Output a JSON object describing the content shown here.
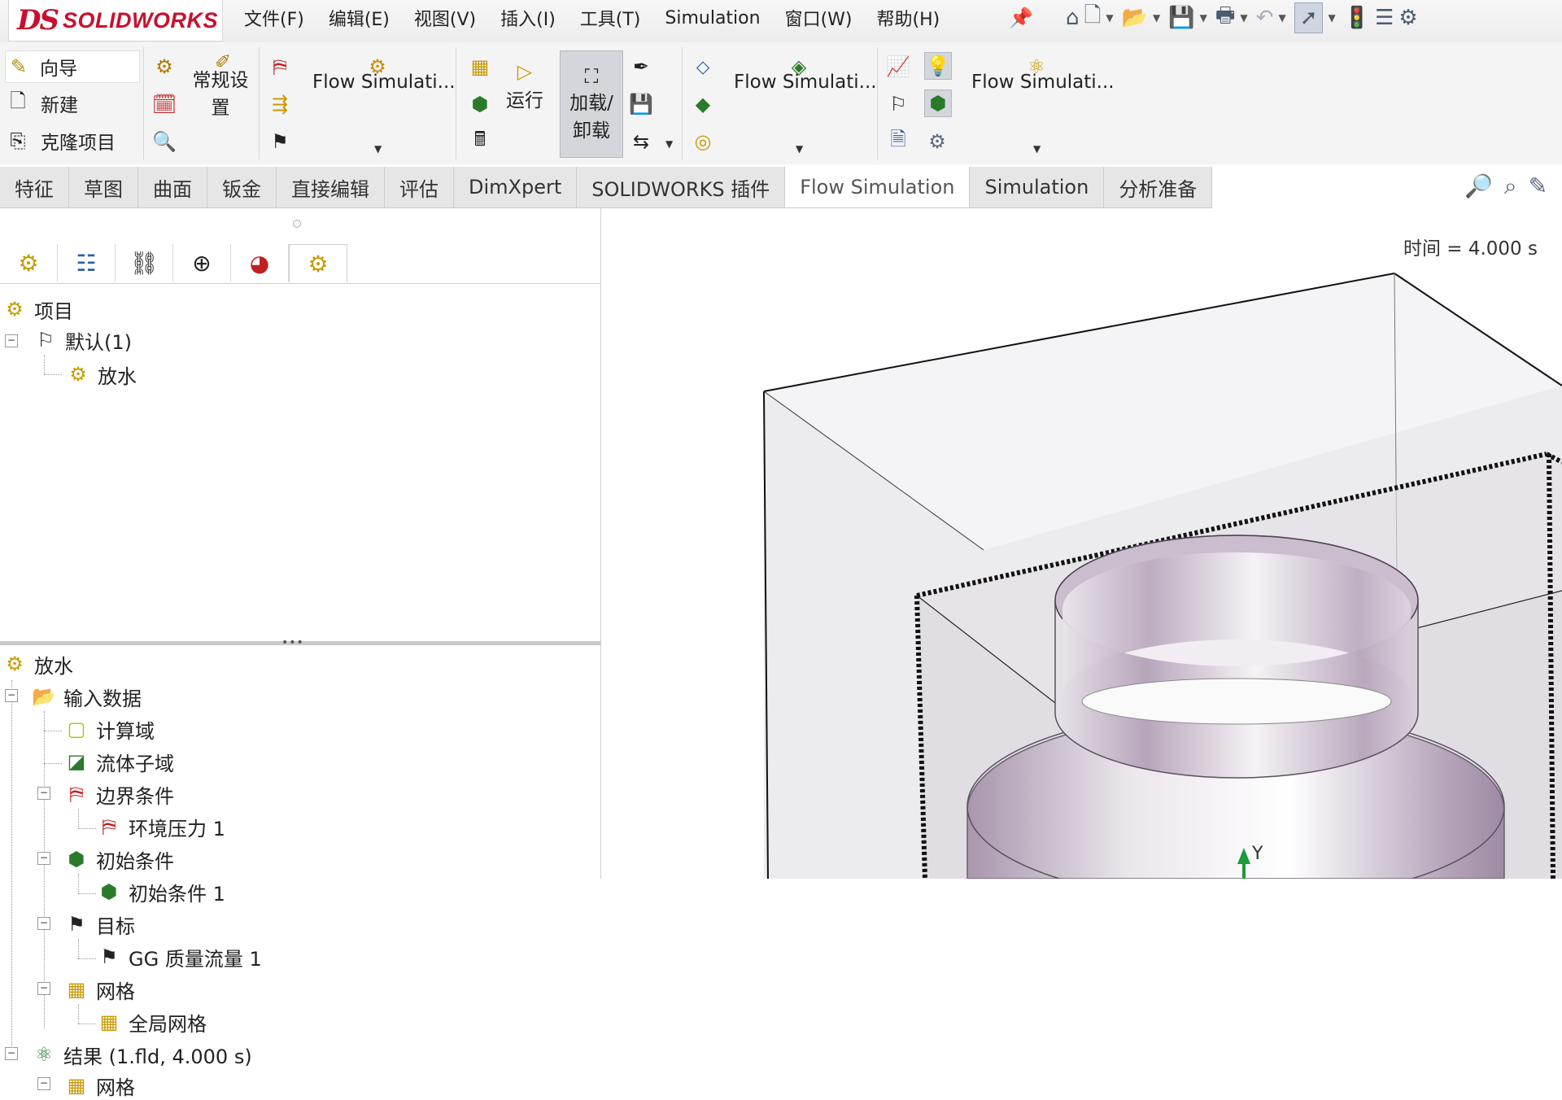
{
  "app": {
    "brand_ds": "DS",
    "brand_name": "SOLIDWORKS"
  },
  "menu": [
    "文件(F)",
    "编辑(E)",
    "视图(V)",
    "插入(I)",
    "工具(T)",
    "Simulation",
    "窗口(W)",
    "帮助(H)"
  ],
  "quick_access_icons": [
    "home-icon",
    "new-document-icon",
    "open-icon",
    "save-icon",
    "print-icon",
    "undo-icon",
    "select-cursor-icon",
    "traffic-light-icon",
    "options-list-icon",
    "gear-icon"
  ],
  "toolbar": {
    "wizard": "向导",
    "new": "新建",
    "clone_project": "克隆项目",
    "general_settings": "常规设置",
    "flow_sim_1": "Flow Simulati...",
    "run": "运行",
    "load_unload": "加载/卸载",
    "flow_sim_2": "Flow Simulati...",
    "flow_sim_3": "Flow Simulati..."
  },
  "tabs": [
    {
      "label": "特征",
      "active": false
    },
    {
      "label": "草图",
      "active": false
    },
    {
      "label": "曲面",
      "active": false
    },
    {
      "label": "钣金",
      "active": false
    },
    {
      "label": "直接编辑",
      "active": false
    },
    {
      "label": "评估",
      "active": false
    },
    {
      "label": "DimXpert",
      "active": false
    },
    {
      "label": "SOLIDWORKS 插件",
      "active": false
    },
    {
      "label": "Flow Simulation",
      "active": true
    },
    {
      "label": "Simulation",
      "active": false
    },
    {
      "label": "分析准备",
      "active": false
    }
  ],
  "project_tree": {
    "root": "项目",
    "config": "默认(1)",
    "project": "放水"
  },
  "analysis_tree": {
    "root": "放水",
    "input_data": "输入数据",
    "computational_domain": "计算域",
    "fluid_subdomain": "流体子域",
    "boundary_conditions": "边界条件",
    "env_pressure": "环境压力 1",
    "initial_conditions": "初始条件",
    "initial_condition_1": "初始条件 1",
    "goals": "目标",
    "gg_goal": "GG 质量流量 1",
    "mesh": "网格",
    "global_mesh": "全局网格",
    "results": "结果 (1.fld, 4.000 s)",
    "results_mesh": "网格"
  },
  "viewport": {
    "time_readout": "时间 = 4.000 s",
    "axis_label": "Y"
  }
}
